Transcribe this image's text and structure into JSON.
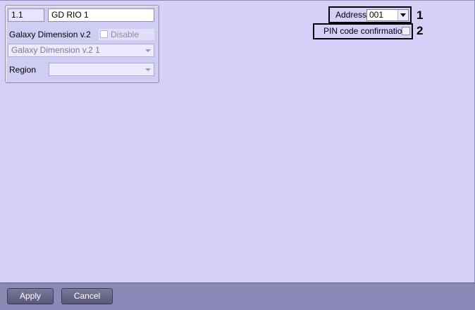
{
  "object_panel": {
    "id_value": "1.1",
    "name_value": "GD RIO 1",
    "type_label": "Galaxy Dimension v.2",
    "disable_label": "Disable",
    "disable_checked": false,
    "type_select_value": "Galaxy Dimension v.2 1",
    "region_label": "Region",
    "region_value": ""
  },
  "settings": {
    "address_label": "Address:",
    "address_value": "001",
    "pin_label": "PIN code confirmation",
    "pin_checked": false,
    "callout_1": "1",
    "callout_2": "2"
  },
  "footer": {
    "apply_label": "Apply",
    "cancel_label": "Cancel"
  },
  "colors": {
    "background": "#d4d0f8",
    "toolbar": "#8b89b6",
    "button": "#5a5878",
    "highlight_border": "#000000"
  },
  "icons": [
    "dropdown-arrow-icon",
    "checkbox-icon"
  ]
}
